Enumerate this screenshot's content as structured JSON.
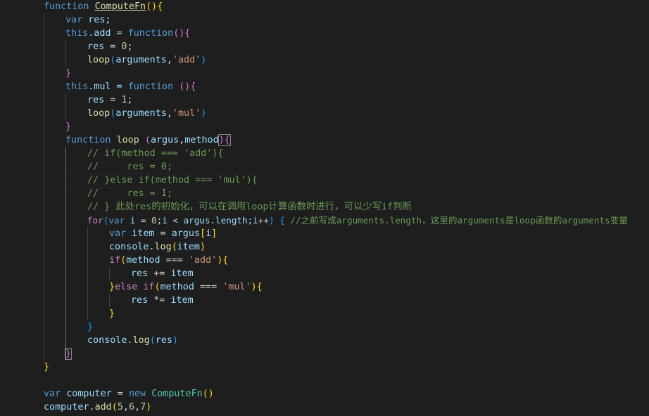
{
  "editor": {
    "theme_colors": {
      "background": "#1e1e1e",
      "keyword": "#569cd6",
      "control": "#c586c0",
      "function": "#dcdcaa",
      "variable": "#9cdcfe",
      "number": "#b5cea8",
      "string": "#ce9178",
      "comment": "#6a9955"
    },
    "code": {
      "l01": [
        "function",
        "ComputeFn",
        "(){"
      ],
      "l02": [
        "var",
        "res;"
      ],
      "l03": [
        "this",
        ".add = ",
        "function",
        "(){"
      ],
      "l04": [
        "res",
        " = ",
        "0",
        ";"
      ],
      "l05": [
        "loop",
        "(",
        "arguments",
        ",",
        "'add'",
        ")"
      ],
      "l06": [
        "}"
      ],
      "l07": [
        "this",
        ".mul = ",
        "function",
        " (){"
      ],
      "l08": [
        "res",
        " = ",
        "1",
        ";"
      ],
      "l09": [
        "loop",
        "(",
        "arguments",
        ",",
        "'mul'",
        ")"
      ],
      "l10": [
        "}"
      ],
      "l11": [
        "function",
        "loop",
        " (",
        "argus",
        ",",
        "method",
        "){"
      ],
      "l12": "// if(method === 'add'){",
      "l13": "//     res = 0;",
      "l14": "// }else if(method === 'mul'){",
      "l15": "//     res = 1;",
      "l16": "// } 此处res的初始化，可以在调用loop计算函数时进行，可以少写if判断",
      "l17": [
        "for",
        "(",
        "var",
        "i",
        " = ",
        "0",
        ";",
        "i",
        " < ",
        "argus",
        ".",
        "length",
        ";",
        "i",
        "++",
        ") {",
        "//之前写成arguments.length，这里的arguments是loop函数的arguments变量"
      ],
      "l18": [
        "var",
        "item",
        " = ",
        "argus",
        "[",
        "i",
        "]"
      ],
      "l19": [
        "console",
        ".",
        "log",
        "(",
        "item",
        ")"
      ],
      "l20": [
        "if",
        "(",
        "method",
        " === ",
        "'add'",
        "){"
      ],
      "l21": [
        "res",
        " += ",
        "item"
      ],
      "l22": [
        "}",
        "else",
        " ",
        "if",
        "(",
        "method",
        " === ",
        "'mul'",
        "){"
      ],
      "l23": [
        "res",
        " *= ",
        "item"
      ],
      "l24": [
        "}"
      ],
      "l25": [
        "}"
      ],
      "l26": [
        "console",
        ".",
        "log",
        "(",
        "res",
        ")"
      ],
      "l27": [
        "}"
      ],
      "l28": [
        "}"
      ],
      "l29": [
        "var",
        "computer",
        " = ",
        "new",
        " ",
        "ComputeFn",
        "()"
      ],
      "l30": [
        "computer",
        ".",
        "add",
        "(",
        "5",
        ",",
        "6",
        ",",
        "7",
        ")"
      ]
    }
  }
}
